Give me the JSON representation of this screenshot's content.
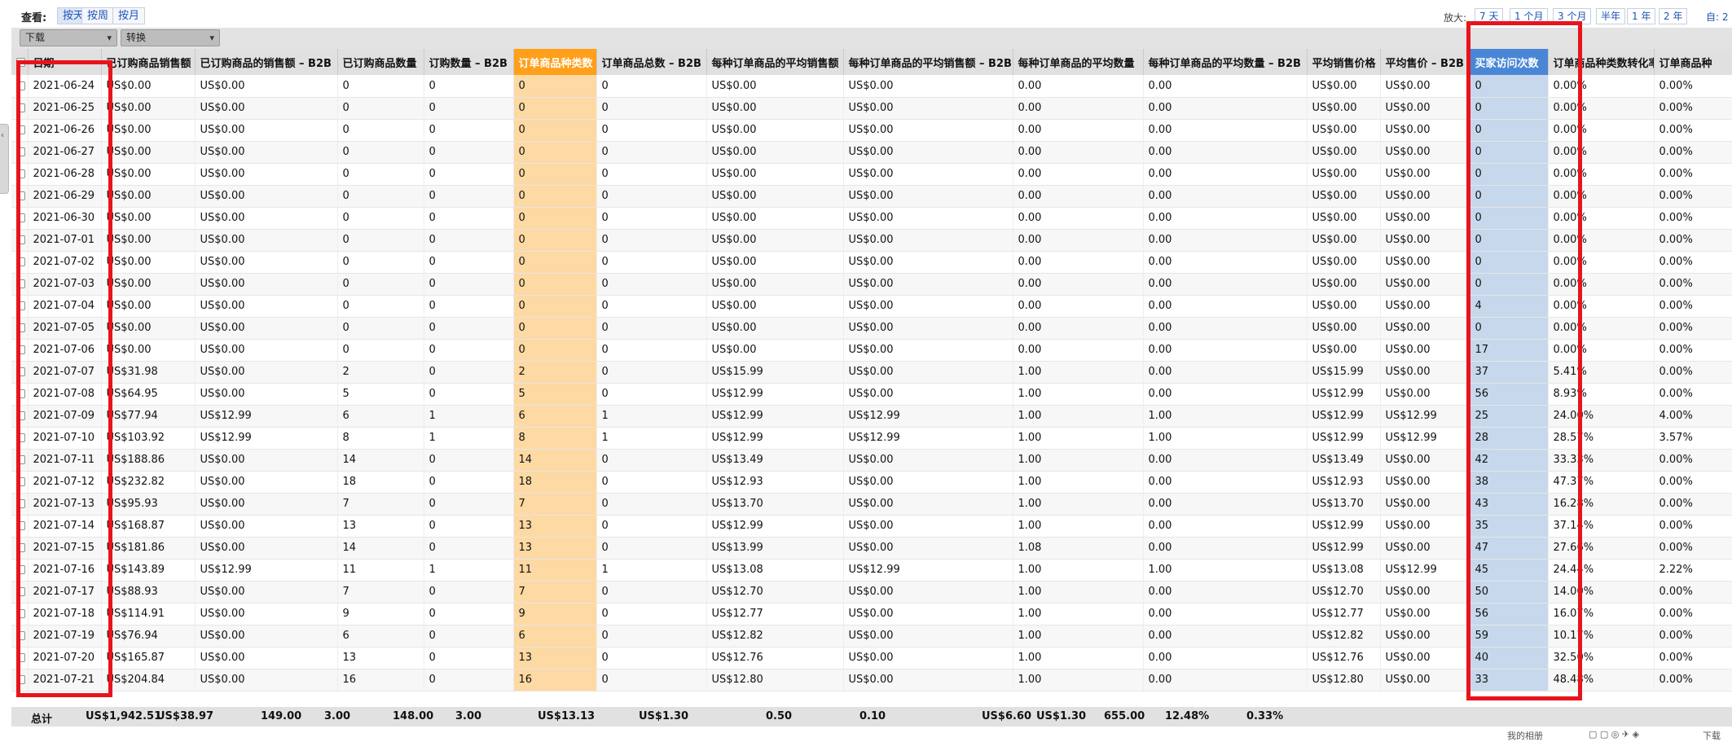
{
  "view": {
    "label": "查看:",
    "buttons": [
      "按天",
      "按周",
      "按月"
    ],
    "active": 0
  },
  "zoom": {
    "label": "放大:",
    "buttons": [
      "7 天",
      "1 个月",
      "3 个月",
      "半年",
      "1 年",
      "2 年"
    ],
    "tail": "自: 2"
  },
  "controls": {
    "download": "下载",
    "convert": "转换"
  },
  "columns": [
    "日期",
    "已订购商品销售额",
    "已订购商品的销售额 – B2B",
    "已订购商品数量",
    "订购数量 – B2B",
    "订单商品种类数",
    "订单商品总数 – B2B",
    "每种订单商品的平均销售额",
    "每种订单商品的平均销售额 – B2B",
    "每种订单商品的平均数量",
    "每种订单商品的平均数量 – B2B",
    "平均销售价格",
    "平均售价 – B2B",
    "买家访问次数",
    "订单商品种类数转化率",
    "订单商品种"
  ],
  "rows": [
    [
      "2021-06-24",
      "US$0.00",
      "US$0.00",
      "0",
      "0",
      "0",
      "0",
      "US$0.00",
      "US$0.00",
      "0.00",
      "0.00",
      "US$0.00",
      "US$0.00",
      "0",
      "0.00%",
      "0.00%"
    ],
    [
      "2021-06-25",
      "US$0.00",
      "US$0.00",
      "0",
      "0",
      "0",
      "0",
      "US$0.00",
      "US$0.00",
      "0.00",
      "0.00",
      "US$0.00",
      "US$0.00",
      "0",
      "0.00%",
      "0.00%"
    ],
    [
      "2021-06-26",
      "US$0.00",
      "US$0.00",
      "0",
      "0",
      "0",
      "0",
      "US$0.00",
      "US$0.00",
      "0.00",
      "0.00",
      "US$0.00",
      "US$0.00",
      "0",
      "0.00%",
      "0.00%"
    ],
    [
      "2021-06-27",
      "US$0.00",
      "US$0.00",
      "0",
      "0",
      "0",
      "0",
      "US$0.00",
      "US$0.00",
      "0.00",
      "0.00",
      "US$0.00",
      "US$0.00",
      "0",
      "0.00%",
      "0.00%"
    ],
    [
      "2021-06-28",
      "US$0.00",
      "US$0.00",
      "0",
      "0",
      "0",
      "0",
      "US$0.00",
      "US$0.00",
      "0.00",
      "0.00",
      "US$0.00",
      "US$0.00",
      "0",
      "0.00%",
      "0.00%"
    ],
    [
      "2021-06-29",
      "US$0.00",
      "US$0.00",
      "0",
      "0",
      "0",
      "0",
      "US$0.00",
      "US$0.00",
      "0.00",
      "0.00",
      "US$0.00",
      "US$0.00",
      "0",
      "0.00%",
      "0.00%"
    ],
    [
      "2021-06-30",
      "US$0.00",
      "US$0.00",
      "0",
      "0",
      "0",
      "0",
      "US$0.00",
      "US$0.00",
      "0.00",
      "0.00",
      "US$0.00",
      "US$0.00",
      "0",
      "0.00%",
      "0.00%"
    ],
    [
      "2021-07-01",
      "US$0.00",
      "US$0.00",
      "0",
      "0",
      "0",
      "0",
      "US$0.00",
      "US$0.00",
      "0.00",
      "0.00",
      "US$0.00",
      "US$0.00",
      "0",
      "0.00%",
      "0.00%"
    ],
    [
      "2021-07-02",
      "US$0.00",
      "US$0.00",
      "0",
      "0",
      "0",
      "0",
      "US$0.00",
      "US$0.00",
      "0.00",
      "0.00",
      "US$0.00",
      "US$0.00",
      "0",
      "0.00%",
      "0.00%"
    ],
    [
      "2021-07-03",
      "US$0.00",
      "US$0.00",
      "0",
      "0",
      "0",
      "0",
      "US$0.00",
      "US$0.00",
      "0.00",
      "0.00",
      "US$0.00",
      "US$0.00",
      "0",
      "0.00%",
      "0.00%"
    ],
    [
      "2021-07-04",
      "US$0.00",
      "US$0.00",
      "0",
      "0",
      "0",
      "0",
      "US$0.00",
      "US$0.00",
      "0.00",
      "0.00",
      "US$0.00",
      "US$0.00",
      "4",
      "0.00%",
      "0.00%"
    ],
    [
      "2021-07-05",
      "US$0.00",
      "US$0.00",
      "0",
      "0",
      "0",
      "0",
      "US$0.00",
      "US$0.00",
      "0.00",
      "0.00",
      "US$0.00",
      "US$0.00",
      "0",
      "0.00%",
      "0.00%"
    ],
    [
      "2021-07-06",
      "US$0.00",
      "US$0.00",
      "0",
      "0",
      "0",
      "0",
      "US$0.00",
      "US$0.00",
      "0.00",
      "0.00",
      "US$0.00",
      "US$0.00",
      "17",
      "0.00%",
      "0.00%"
    ],
    [
      "2021-07-07",
      "US$31.98",
      "US$0.00",
      "2",
      "0",
      "2",
      "0",
      "US$15.99",
      "US$0.00",
      "1.00",
      "0.00",
      "US$15.99",
      "US$0.00",
      "37",
      "5.41%",
      "0.00%"
    ],
    [
      "2021-07-08",
      "US$64.95",
      "US$0.00",
      "5",
      "0",
      "5",
      "0",
      "US$12.99",
      "US$0.00",
      "1.00",
      "0.00",
      "US$12.99",
      "US$0.00",
      "56",
      "8.93%",
      "0.00%"
    ],
    [
      "2021-07-09",
      "US$77.94",
      "US$12.99",
      "6",
      "1",
      "6",
      "1",
      "US$12.99",
      "US$12.99",
      "1.00",
      "1.00",
      "US$12.99",
      "US$12.99",
      "25",
      "24.00%",
      "4.00%"
    ],
    [
      "2021-07-10",
      "US$103.92",
      "US$12.99",
      "8",
      "1",
      "8",
      "1",
      "US$12.99",
      "US$12.99",
      "1.00",
      "1.00",
      "US$12.99",
      "US$12.99",
      "28",
      "28.57%",
      "3.57%"
    ],
    [
      "2021-07-11",
      "US$188.86",
      "US$0.00",
      "14",
      "0",
      "14",
      "0",
      "US$13.49",
      "US$0.00",
      "1.00",
      "0.00",
      "US$13.49",
      "US$0.00",
      "42",
      "33.33%",
      "0.00%"
    ],
    [
      "2021-07-12",
      "US$232.82",
      "US$0.00",
      "18",
      "0",
      "18",
      "0",
      "US$12.93",
      "US$0.00",
      "1.00",
      "0.00",
      "US$12.93",
      "US$0.00",
      "38",
      "47.37%",
      "0.00%"
    ],
    [
      "2021-07-13",
      "US$95.93",
      "US$0.00",
      "7",
      "0",
      "7",
      "0",
      "US$13.70",
      "US$0.00",
      "1.00",
      "0.00",
      "US$13.70",
      "US$0.00",
      "43",
      "16.28%",
      "0.00%"
    ],
    [
      "2021-07-14",
      "US$168.87",
      "US$0.00",
      "13",
      "0",
      "13",
      "0",
      "US$12.99",
      "US$0.00",
      "1.00",
      "0.00",
      "US$12.99",
      "US$0.00",
      "35",
      "37.14%",
      "0.00%"
    ],
    [
      "2021-07-15",
      "US$181.86",
      "US$0.00",
      "14",
      "0",
      "13",
      "0",
      "US$13.99",
      "US$0.00",
      "1.08",
      "0.00",
      "US$12.99",
      "US$0.00",
      "47",
      "27.66%",
      "0.00%"
    ],
    [
      "2021-07-16",
      "US$143.89",
      "US$12.99",
      "11",
      "1",
      "11",
      "1",
      "US$13.08",
      "US$12.99",
      "1.00",
      "1.00",
      "US$13.08",
      "US$12.99",
      "45",
      "24.44%",
      "2.22%"
    ],
    [
      "2021-07-17",
      "US$88.93",
      "US$0.00",
      "7",
      "0",
      "7",
      "0",
      "US$12.70",
      "US$0.00",
      "1.00",
      "0.00",
      "US$12.70",
      "US$0.00",
      "50",
      "14.00%",
      "0.00%"
    ],
    [
      "2021-07-18",
      "US$114.91",
      "US$0.00",
      "9",
      "0",
      "9",
      "0",
      "US$12.77",
      "US$0.00",
      "1.00",
      "0.00",
      "US$12.77",
      "US$0.00",
      "56",
      "16.07%",
      "0.00%"
    ],
    [
      "2021-07-19",
      "US$76.94",
      "US$0.00",
      "6",
      "0",
      "6",
      "0",
      "US$12.82",
      "US$0.00",
      "1.00",
      "0.00",
      "US$12.82",
      "US$0.00",
      "59",
      "10.17%",
      "0.00%"
    ],
    [
      "2021-07-20",
      "US$165.87",
      "US$0.00",
      "13",
      "0",
      "13",
      "0",
      "US$12.76",
      "US$0.00",
      "1.00",
      "0.00",
      "US$12.76",
      "US$0.00",
      "40",
      "32.50%",
      "0.00%"
    ],
    [
      "2021-07-21",
      "US$204.84",
      "US$0.00",
      "16",
      "0",
      "16",
      "0",
      "US$12.80",
      "US$0.00",
      "1.00",
      "0.00",
      "US$12.80",
      "US$0.00",
      "33",
      "48.48%",
      "0.00%"
    ]
  ],
  "totals": [
    "总计",
    "US$1,942.51",
    "US$38.97",
    "149.00",
    "3.00",
    "148.00",
    "3.00",
    "US$13.13",
    "US$1.30",
    "0.50",
    "0.10",
    "US$6.60",
    "US$1.30",
    "655.00",
    "12.48%",
    "0.33%"
  ],
  "highlight": {
    "orange": "#ff9f1a",
    "blue": "#4a86d6",
    "annotation_red": "#e8141c"
  },
  "bottom_bar": {
    "left": "我的相册",
    "right": "下载"
  }
}
